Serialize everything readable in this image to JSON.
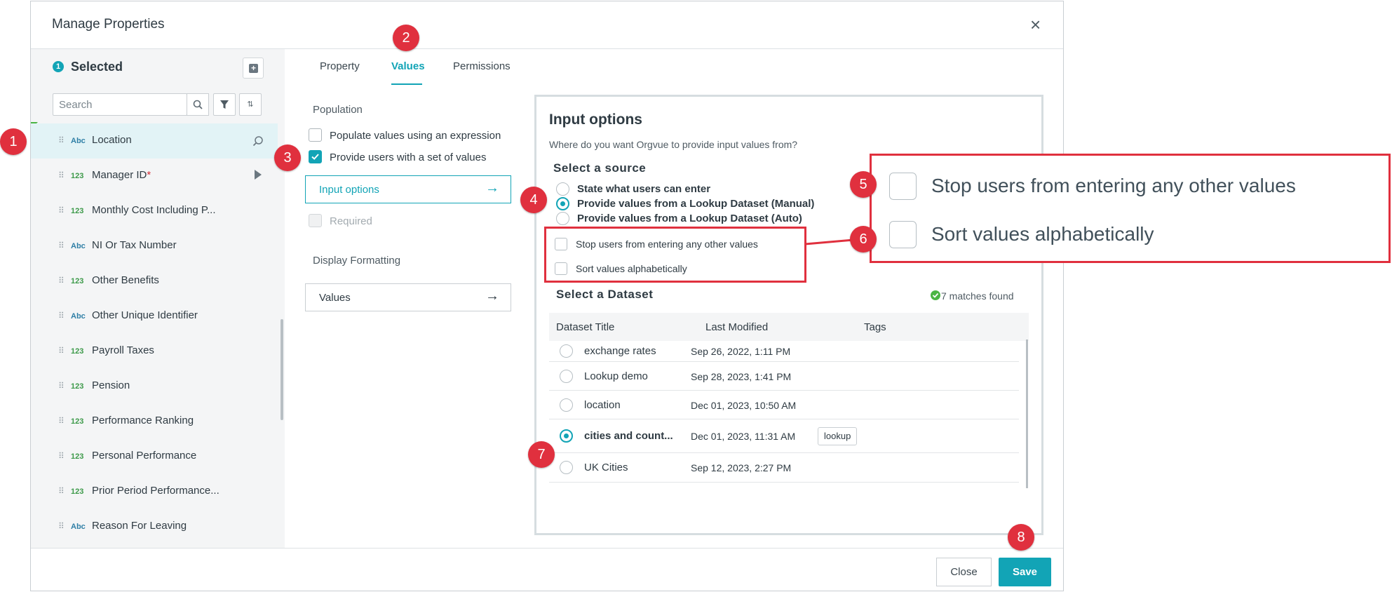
{
  "dialog": {
    "title": "Manage Properties",
    "close_glyph": "×"
  },
  "sidebar": {
    "selected_count": "1",
    "selected_label": "Selected",
    "add_glyph": "+",
    "search_placeholder": "Search",
    "sort_glyph": "⇅",
    "items": [
      {
        "type": "Abc",
        "label": "Location",
        "active": true
      },
      {
        "type": "123",
        "label": "Manager ID",
        "required": "*"
      },
      {
        "type": "123",
        "label": "Monthly Cost Including P..."
      },
      {
        "type": "Abc",
        "label": "NI Or Tax Number"
      },
      {
        "type": "123",
        "label": "Other Benefits"
      },
      {
        "type": "Abc",
        "label": "Other Unique Identifier"
      },
      {
        "type": "123",
        "label": "Payroll Taxes"
      },
      {
        "type": "123",
        "label": "Pension"
      },
      {
        "type": "123",
        "label": "Performance Ranking"
      },
      {
        "type": "123",
        "label": "Personal Performance"
      },
      {
        "type": "123",
        "label": "Prior Period Performance..."
      },
      {
        "type": "Abc",
        "label": "Reason For Leaving"
      }
    ]
  },
  "tabs": [
    {
      "label": "Property"
    },
    {
      "label": "Values",
      "active": true
    },
    {
      "label": "Permissions"
    }
  ],
  "values_tab": {
    "population_label": "Population",
    "populate_expression": "Populate values using an expression",
    "provide_set": "Provide users with a set of values",
    "input_options_btn": "Input options",
    "required": "Required",
    "display_formatting": "Display Formatting",
    "values_btn": "Values",
    "arrow_glyph": "→"
  },
  "input_options": {
    "title": "Input options",
    "subtitle": "Where do you want Orgvue to provide input values from?",
    "select_source": "Select a source",
    "sources": [
      {
        "label": "State what users can enter",
        "selected": false
      },
      {
        "label": "Provide values from a Lookup Dataset (Manual)",
        "selected": true
      },
      {
        "label": "Provide values from a Lookup Dataset (Auto)",
        "selected": false
      }
    ],
    "stop_users": "Stop users from entering any other values",
    "sort_alpha": "Sort values alphabetically",
    "select_dataset": "Select a Dataset",
    "matches": "7 matches found",
    "columns": [
      "Dataset Title",
      "Last Modified",
      "Tags"
    ],
    "rows": [
      {
        "title": "exchange rates",
        "modified": "Sep 26, 2022, 1:11 PM",
        "tag": "",
        "selected": false
      },
      {
        "title": "Lookup demo",
        "modified": "Sep 28, 2023, 1:41 PM",
        "tag": "",
        "selected": false
      },
      {
        "title": "location",
        "modified": "Dec 01, 2023, 10:50 AM",
        "tag": "",
        "selected": false
      },
      {
        "title": "cities and count...",
        "modified": "Dec 01, 2023, 11:31 AM",
        "tag": "lookup",
        "selected": true
      },
      {
        "title": "UK Cities",
        "modified": "Sep 12, 2023, 2:27 PM",
        "tag": "",
        "selected": false
      }
    ]
  },
  "zoom_callout": {
    "stop_users": "Stop users from entering any other values",
    "sort_alpha": "Sort values alphabetically"
  },
  "footer": {
    "close": "Close",
    "save": "Save"
  },
  "callouts": [
    "1",
    "2",
    "3",
    "4",
    "5",
    "6",
    "7",
    "8"
  ],
  "colors": {
    "accent": "#12a4b6",
    "callout_red": "#e0303e"
  }
}
